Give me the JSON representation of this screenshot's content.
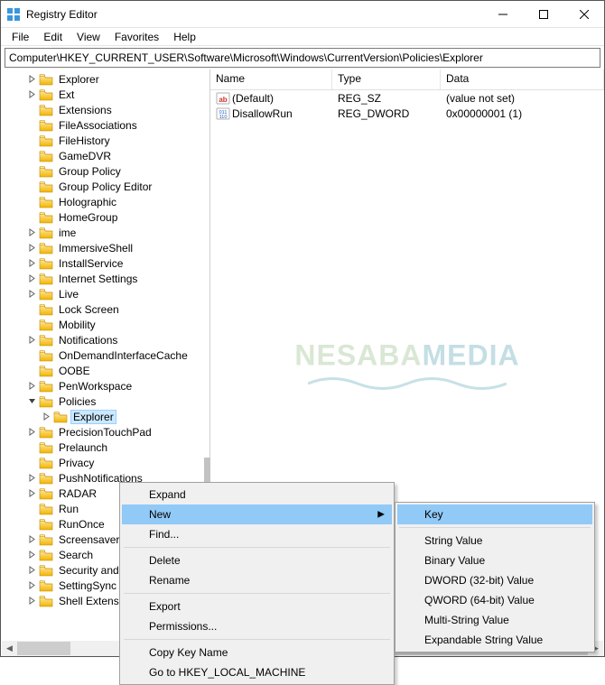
{
  "window": {
    "title": "Registry Editor"
  },
  "menubar": {
    "items": [
      "File",
      "Edit",
      "View",
      "Favorites",
      "Help"
    ]
  },
  "addressbar": {
    "path": "Computer\\HKEY_CURRENT_USER\\Software\\Microsoft\\Windows\\CurrentVersion\\Policies\\Explorer"
  },
  "tree": {
    "items": [
      {
        "label": "Explorer",
        "expander": "chevron-right"
      },
      {
        "label": "Ext",
        "expander": "chevron-right"
      },
      {
        "label": "Extensions",
        "expander": ""
      },
      {
        "label": "FileAssociations",
        "expander": ""
      },
      {
        "label": "FileHistory",
        "expander": ""
      },
      {
        "label": "GameDVR",
        "expander": ""
      },
      {
        "label": "Group Policy",
        "expander": ""
      },
      {
        "label": "Group Policy Editor",
        "expander": ""
      },
      {
        "label": "Holographic",
        "expander": ""
      },
      {
        "label": "HomeGroup",
        "expander": ""
      },
      {
        "label": "ime",
        "expander": "chevron-right"
      },
      {
        "label": "ImmersiveShell",
        "expander": "chevron-right"
      },
      {
        "label": "InstallService",
        "expander": "chevron-right"
      },
      {
        "label": "Internet Settings",
        "expander": "chevron-right"
      },
      {
        "label": "Live",
        "expander": "chevron-right"
      },
      {
        "label": "Lock Screen",
        "expander": ""
      },
      {
        "label": "Mobility",
        "expander": ""
      },
      {
        "label": "Notifications",
        "expander": "chevron-right"
      },
      {
        "label": "OnDemandInterfaceCache",
        "expander": ""
      },
      {
        "label": "OOBE",
        "expander": ""
      },
      {
        "label": "PenWorkspace",
        "expander": "chevron-right"
      },
      {
        "label": "Policies",
        "expander": "chevron-down",
        "expanded": true
      },
      {
        "label": "Explorer",
        "expander": "chevron-right",
        "deep": true,
        "selected": true
      },
      {
        "label": "PrecisionTouchPad",
        "expander": "chevron-right"
      },
      {
        "label": "Prelaunch",
        "expander": ""
      },
      {
        "label": "Privacy",
        "expander": ""
      },
      {
        "label": "PushNotifications",
        "expander": "chevron-right"
      },
      {
        "label": "RADAR",
        "expander": "chevron-right"
      },
      {
        "label": "Run",
        "expander": ""
      },
      {
        "label": "RunOnce",
        "expander": ""
      },
      {
        "label": "Screensavers",
        "expander": "chevron-right"
      },
      {
        "label": "Search",
        "expander": "chevron-right"
      },
      {
        "label": "Security and Maintenance",
        "expander": "chevron-right"
      },
      {
        "label": "SettingSync",
        "expander": "chevron-right"
      },
      {
        "label": "Shell Extensions",
        "expander": "chevron-right"
      }
    ]
  },
  "list": {
    "columns": {
      "name": "Name",
      "type": "Type",
      "data": "Data"
    },
    "rows": [
      {
        "icon": "string-value-icon",
        "name": "(Default)",
        "type": "REG_SZ",
        "data": "(value not set)"
      },
      {
        "icon": "dword-value-icon",
        "name": "DisallowRun",
        "type": "REG_DWORD",
        "data": "0x00000001 (1)"
      }
    ]
  },
  "watermark": {
    "part1": "NESABA",
    "part2": "MEDIA"
  },
  "context_menu": {
    "items": [
      {
        "label": "Expand",
        "kind": "item"
      },
      {
        "label": "New",
        "kind": "item",
        "submenu": true,
        "hover": true
      },
      {
        "label": "Find...",
        "kind": "item"
      },
      {
        "kind": "sep"
      },
      {
        "label": "Delete",
        "kind": "item"
      },
      {
        "label": "Rename",
        "kind": "item"
      },
      {
        "kind": "sep"
      },
      {
        "label": "Export",
        "kind": "item"
      },
      {
        "label": "Permissions...",
        "kind": "item"
      },
      {
        "kind": "sep"
      },
      {
        "label": "Copy Key Name",
        "kind": "item"
      },
      {
        "label": "Go to HKEY_LOCAL_MACHINE",
        "kind": "item"
      }
    ],
    "submenu": [
      {
        "label": "Key",
        "hover": true
      },
      {
        "kind": "sep"
      },
      {
        "label": "String Value"
      },
      {
        "label": "Binary Value"
      },
      {
        "label": "DWORD (32-bit) Value"
      },
      {
        "label": "QWORD (64-bit) Value"
      },
      {
        "label": "Multi-String Value"
      },
      {
        "label": "Expandable String Value"
      }
    ]
  }
}
